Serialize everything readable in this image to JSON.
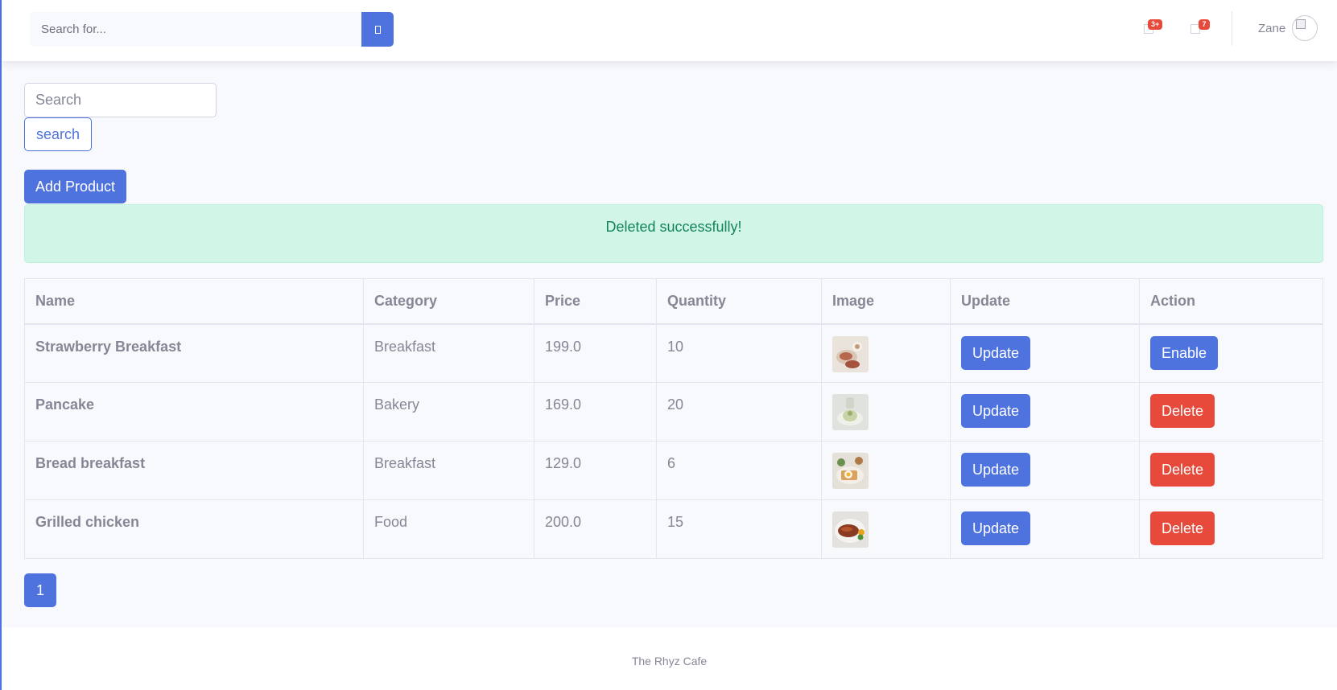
{
  "topbar": {
    "search_placeholder": "Search for...",
    "search_button_icon": "search-icon",
    "alerts_badge": "3+",
    "messages_badge": "7",
    "user_name": "Zane"
  },
  "filter": {
    "placeholder": "Search",
    "button_label": "search"
  },
  "add_product_label": "Add Product",
  "alert_message": "Deleted successfully!",
  "table": {
    "headers": [
      "Name",
      "Category",
      "Price",
      "Quantity",
      "Image",
      "Update",
      "Action"
    ],
    "rows": [
      {
        "name": "Strawberry Breakfast",
        "category": "Breakfast",
        "price": "199.0",
        "quantity": "10",
        "update": "Update",
        "action": "Enable",
        "action_color": "#4e73df"
      },
      {
        "name": "Pancake",
        "category": "Bakery",
        "price": "169.0",
        "quantity": "20",
        "update": "Update",
        "action": "Delete",
        "action_color": "#e74a3b"
      },
      {
        "name": "Bread breakfast",
        "category": "Breakfast",
        "price": "129.0",
        "quantity": "6",
        "update": "Update",
        "action": "Delete",
        "action_color": "#e74a3b"
      },
      {
        "name": "Grilled chicken",
        "category": "Food",
        "price": "200.0",
        "quantity": "15",
        "update": "Update",
        "action": "Delete",
        "action_color": "#e74a3b"
      }
    ]
  },
  "pagination": {
    "current": "1"
  },
  "footer_text": "The Rhyz Cafe",
  "colors": {
    "primary": "#4e73df",
    "danger": "#e74a3b",
    "success_bg": "#d1f5e6",
    "success_text": "#13855c"
  }
}
